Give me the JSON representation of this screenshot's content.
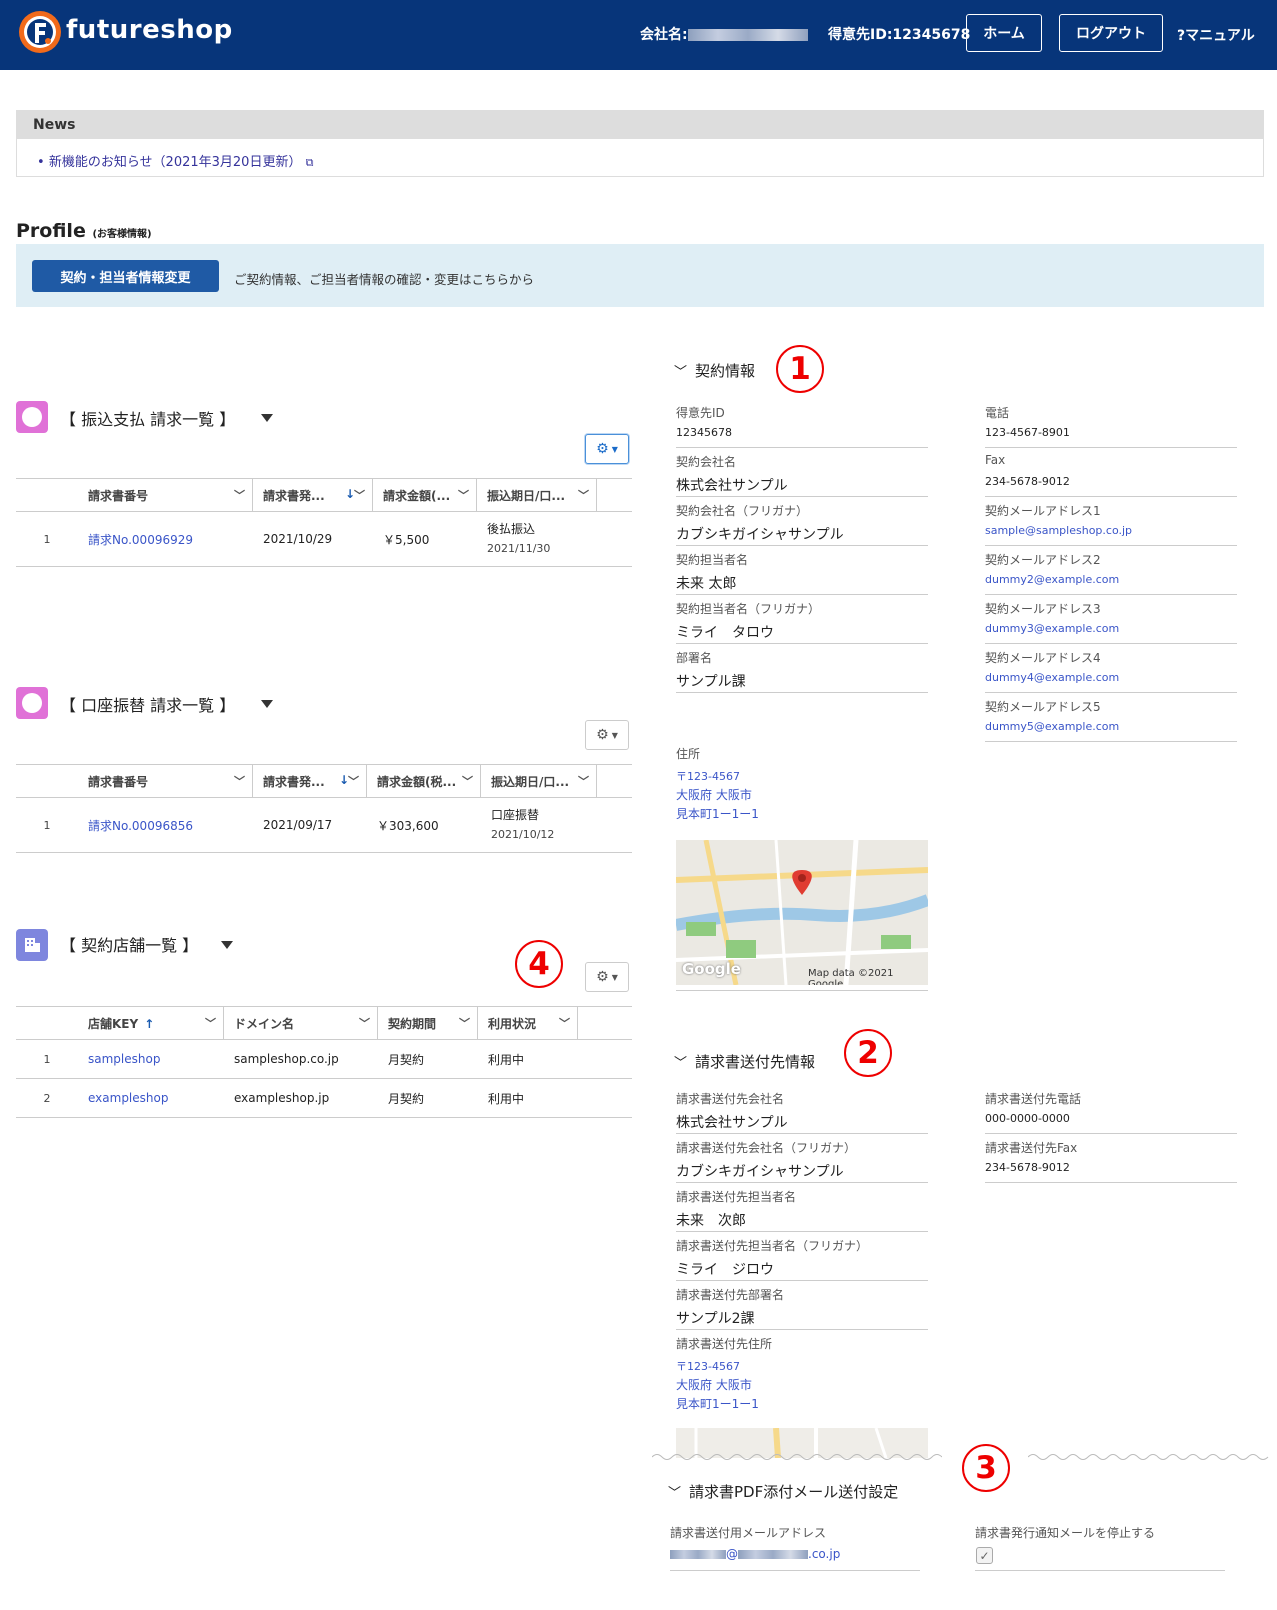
{
  "header": {
    "brand": "futureshop",
    "company_label": "会社名:",
    "customer_id_label": "得意先ID:12345678",
    "home_btn": "ホーム",
    "logout_btn": "ログアウト",
    "manual": "?マニュアル",
    "bg_color": "#07357a"
  },
  "news": {
    "title": "News",
    "item": "新機能のお知らせ（2021年3月20日更新）"
  },
  "profile": {
    "title": "Profile",
    "title_small": "(お客様情報)",
    "button": "契約・担当者情報変更",
    "description": "ご契約情報、ご担当者情報の確認・変更はこちらから"
  },
  "furikomi": {
    "title": "【 振込支払 請求一覧 】",
    "columns": [
      "請求書番号",
      "請求書発...",
      "請求金額(...",
      "振込期日/口..."
    ],
    "rows": [
      {
        "n": "1",
        "id": "請求No.00096929",
        "date": "2021/10/29",
        "amt": "￥5,500",
        "pay": "後払振込",
        "payd": "2021/11/30"
      }
    ]
  },
  "koza": {
    "title": "【 口座振替 請求一覧 】",
    "columns": [
      "請求書番号",
      "請求書発...",
      "請求金額(税...",
      "振込期日/口..."
    ],
    "rows": [
      {
        "n": "1",
        "id": "請求No.00096856",
        "date": "2021/09/17",
        "amt": "￥303,600",
        "pay": "口座振替",
        "payd": "2021/10/12"
      }
    ]
  },
  "stores": {
    "title": "【 契約店舗一覧 】",
    "columns": [
      "店舗KEY",
      "ドメイン名",
      "契約期間",
      "利用状況"
    ],
    "rows": [
      {
        "n": "1",
        "key": "sampleshop",
        "domain": "sampleshop.co.jp",
        "term": "月契約",
        "status": "利用中"
      },
      {
        "n": "2",
        "key": "exampleshop",
        "domain": "exampleshop.jp",
        "term": "月契約",
        "status": "利用中"
      }
    ]
  },
  "contract": {
    "title": "契約情報",
    "left": [
      {
        "label": "得意先ID",
        "value": "12345678"
      },
      {
        "label": "契約会社名",
        "value": "株式会社サンプル"
      },
      {
        "label": "契約会社名（フリガナ）",
        "value": "カブシキガイシャサンプル"
      },
      {
        "label": "契約担当者名",
        "value": "未来 太郎"
      },
      {
        "label": "契約担当者名（フリガナ）",
        "value": "ミライ　タロウ"
      },
      {
        "label": "部署名",
        "value": "サンプル課"
      }
    ],
    "right": [
      {
        "label": "電話",
        "value": "123-4567-8901"
      },
      {
        "label": "Fax",
        "value": "234-5678-9012"
      },
      {
        "label": "契約メールアドレス1",
        "value": "sample@sampleshop.co.jp"
      },
      {
        "label": "契約メールアドレス2",
        "value": "dummy2@example.com"
      },
      {
        "label": "契約メールアドレス3",
        "value": "dummy3@example.com"
      },
      {
        "label": "契約メールアドレス4",
        "value": "dummy4@example.com"
      },
      {
        "label": "契約メールアドレス5",
        "value": "dummy5@example.com"
      }
    ],
    "address_label": "住所",
    "address": [
      "〒123-4567",
      "大阪府 大阪市",
      "見本町1ー1ー1"
    ],
    "map_credit": "Map data ©2021 Google",
    "map_logo": "Google"
  },
  "billing": {
    "title": "請求書送付先情報",
    "left": [
      {
        "label": "請求書送付先会社名",
        "value": "株式会社サンプル"
      },
      {
        "label": "請求書送付先会社名（フリガナ）",
        "value": "カブシキガイシャサンプル"
      },
      {
        "label": "請求書送付先担当者名",
        "value": "未来　次郎"
      },
      {
        "label": "請求書送付先担当者名（フリガナ）",
        "value": "ミライ　ジロウ"
      },
      {
        "label": "請求書送付先部署名",
        "value": "サンプル2課"
      }
    ],
    "right": [
      {
        "label": "請求書送付先電話",
        "value": "000-0000-0000"
      },
      {
        "label": "請求書送付先Fax",
        "value": "234-5678-9012"
      }
    ],
    "address_label": "請求書送付先住所",
    "address": [
      "〒123-4567",
      "大阪府 大阪市",
      "見本町1ー1ー1"
    ]
  },
  "pdf": {
    "title": "請求書PDF添付メール送付設定",
    "email_label": "請求書送付用メールアドレス",
    "email_suffix": ".co.jp",
    "email_at": "@",
    "stop_label": "請求書発行通知メールを停止する",
    "stop_checked": "✓"
  },
  "badges": {
    "b1": "1",
    "b2": "2",
    "b3": "3",
    "b4": "4"
  }
}
